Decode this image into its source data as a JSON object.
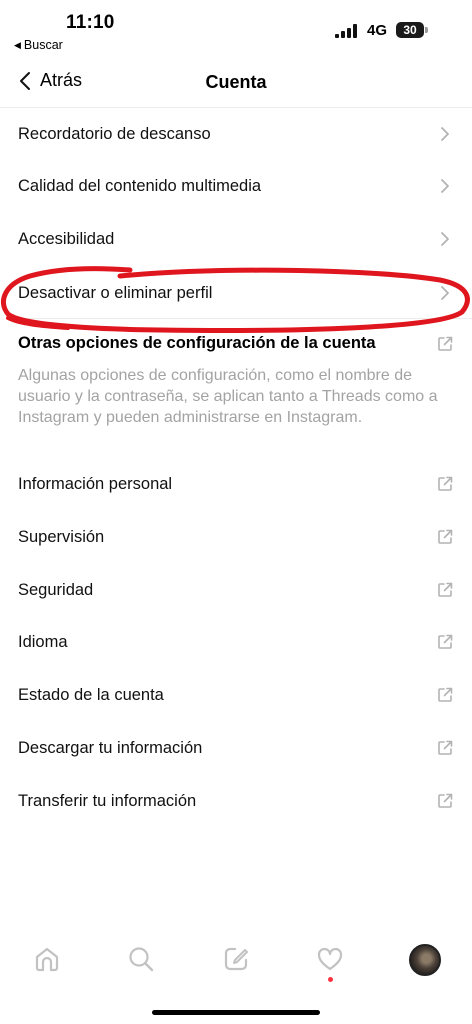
{
  "status_bar": {
    "time": "11:10",
    "back_app": "Buscar",
    "network": "4G",
    "battery": "30"
  },
  "header": {
    "back_label": "Atrás",
    "title": "Cuenta"
  },
  "menu_items": [
    {
      "label": "Recordatorio de descanso",
      "trailing": "chevron-right-icon"
    },
    {
      "label": "Calidad del contenido multimedia",
      "trailing": "chevron-right-icon"
    },
    {
      "label": "Accesibilidad",
      "trailing": "chevron-right-icon"
    },
    {
      "label": "Desactivar o eliminar perfil",
      "trailing": "chevron-right-icon"
    }
  ],
  "other_section": {
    "title": "Otras opciones de configuración de la cuenta",
    "description": "Algunas opciones de configuración, como el nombre de usuario y la contraseña, se aplican tanto a Threads como a Instagram y pueden administrarse en Instagram.",
    "items": [
      {
        "label": "Información personal",
        "trailing": "external-link-icon"
      },
      {
        "label": "Supervisión",
        "trailing": "external-link-icon"
      },
      {
        "label": "Seguridad",
        "trailing": "external-link-icon"
      },
      {
        "label": "Idioma",
        "trailing": "external-link-icon"
      },
      {
        "label": "Estado de la cuenta",
        "trailing": "external-link-icon"
      },
      {
        "label": "Descargar tu información",
        "trailing": "external-link-icon"
      },
      {
        "label": "Transferir tu información",
        "trailing": "external-link-icon"
      }
    ]
  },
  "tab_bar": {
    "tabs": [
      "home-icon",
      "search-icon",
      "compose-icon",
      "heart-icon",
      "avatar"
    ],
    "notification_color": "#ff3040"
  },
  "colors": {
    "annotation": "#e0161e",
    "chevron": "#b3b3b3",
    "secondary_text": "#a3a3a3"
  }
}
